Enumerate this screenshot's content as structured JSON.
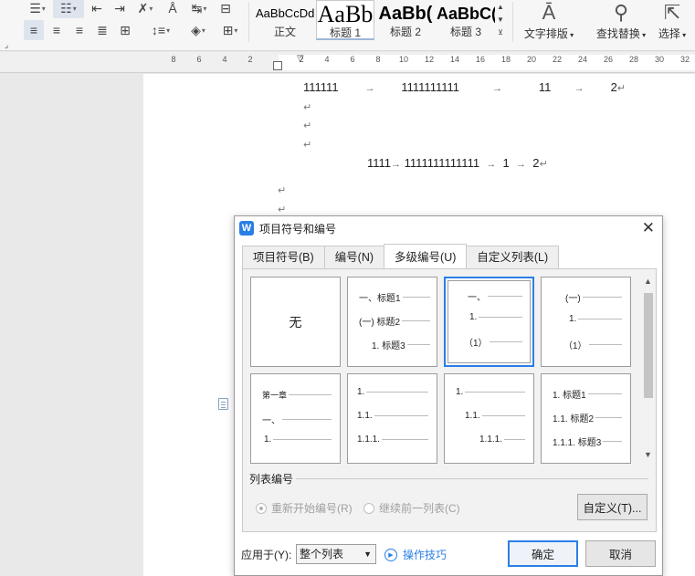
{
  "ribbon": {
    "styles": [
      {
        "sample": "AaBbCcDd",
        "label": "正文"
      },
      {
        "sample": "AaBb",
        "label": "标题 1"
      },
      {
        "sample": "AaBb(",
        "label": "标题 2"
      },
      {
        "sample": "AaBbC(",
        "label": "标题 3"
      }
    ],
    "text_layout_label": "文字排版",
    "find_replace_label": "查找替换",
    "select_label": "选择"
  },
  "ruler": {
    "ticks": [
      "8",
      "6",
      "4",
      "2",
      "2",
      "4",
      "6",
      "8",
      "10",
      "12",
      "14",
      "16",
      "18",
      "20",
      "22",
      "24",
      "26",
      "28",
      "30",
      "32"
    ]
  },
  "document": {
    "line1": [
      "111111",
      "1111111111",
      "11",
      "2"
    ],
    "line2": [
      "1111",
      "1111111111111",
      "1",
      "2"
    ],
    "arrow_glyph": "→",
    "return_glyph": "↵"
  },
  "dialog": {
    "title": "项目符号和编号",
    "tabs": [
      "项目符号(B)",
      "编号(N)",
      "多级编号(U)",
      "自定义列表(L)"
    ],
    "active_tab": 2,
    "gallery": {
      "none_label": "无",
      "cell2": [
        "一、标题1",
        "(一) 标题2",
        "1. 标题3"
      ],
      "cell3": [
        "一、",
        "1.",
        "（1）"
      ],
      "cell4": [
        "(一)",
        "1.",
        "（1）"
      ],
      "cell5": [
        "第一章",
        "一、",
        "1."
      ],
      "cell6": [
        "1.",
        "1.1.",
        "1.1.1."
      ],
      "cell7": [
        "1.",
        "1.1.",
        "1.1.1."
      ],
      "cell8": [
        "1. 标题1",
        "1.1. 标题2",
        "1.1.1. 标题3"
      ]
    },
    "list_numbering_label": "列表编号",
    "restart_label": "重新开始编号(R)",
    "continue_label": "继续前一列表(C)",
    "customize_label": "自定义(T)...",
    "apply_label": "应用于(Y):",
    "apply_value": "整个列表",
    "tips_label": "操作技巧",
    "ok_label": "确定",
    "cancel_label": "取消"
  },
  "colors": {
    "accent": "#2a7fe6"
  }
}
